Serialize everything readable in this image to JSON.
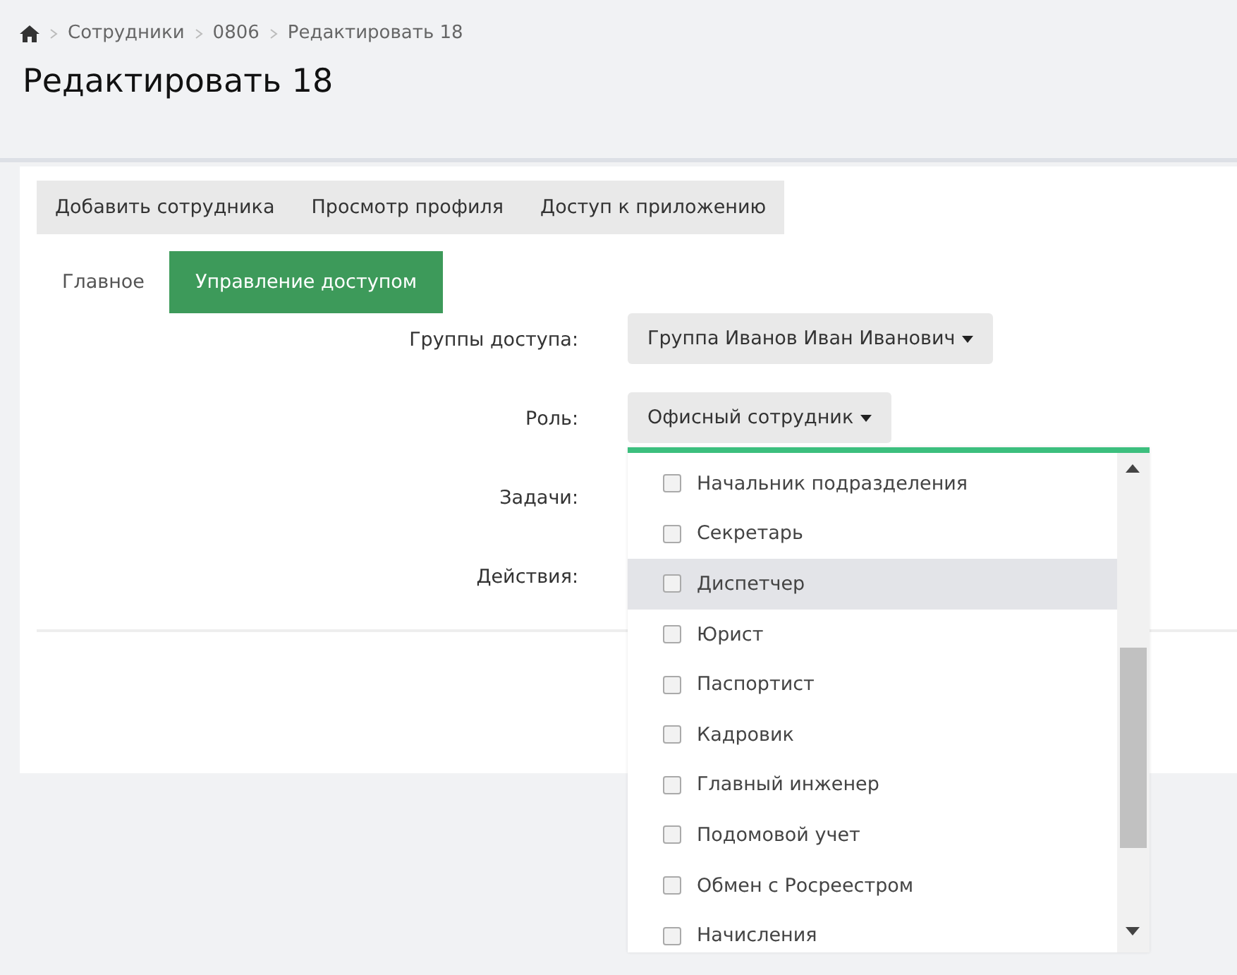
{
  "breadcrumb": [
    "Сотрудники",
    "0806",
    "Редактировать 18"
  ],
  "title": "Редактировать 18",
  "toolbar": [
    "Добавить сотрудника",
    "Просмотр профиля",
    "Доступ к приложению"
  ],
  "tabs": [
    {
      "label": "Главное",
      "selected": false
    },
    {
      "label": "Управление доступом",
      "selected": true
    }
  ],
  "form": [
    {
      "label": "Группы доступа:",
      "value": "Группа Иванов Иван Иванович"
    },
    {
      "label": "Роль:",
      "value": "Офисный сотрудник",
      "options": [
        {
          "label": "Начальник подразделения",
          "checked": false,
          "highlighted": false
        },
        {
          "label": "Секретарь",
          "checked": false,
          "highlighted": false
        },
        {
          "label": "Диспетчер",
          "checked": false,
          "highlighted": true
        },
        {
          "label": "Юрист",
          "checked": false,
          "highlighted": false
        },
        {
          "label": "Паспортист",
          "checked": false,
          "highlighted": false
        },
        {
          "label": "Кадровик",
          "checked": false,
          "highlighted": false
        },
        {
          "label": "Главный инженер",
          "checked": false,
          "highlighted": false
        },
        {
          "label": "Подомовой учет",
          "checked": false,
          "highlighted": false
        },
        {
          "label": "Обмен с Росреестром",
          "checked": false,
          "highlighted": false
        },
        {
          "label": "Начисления",
          "checked": false,
          "highlighted": false
        }
      ]
    },
    {
      "label": "Задачи:"
    },
    {
      "label": "Действия:"
    }
  ]
}
